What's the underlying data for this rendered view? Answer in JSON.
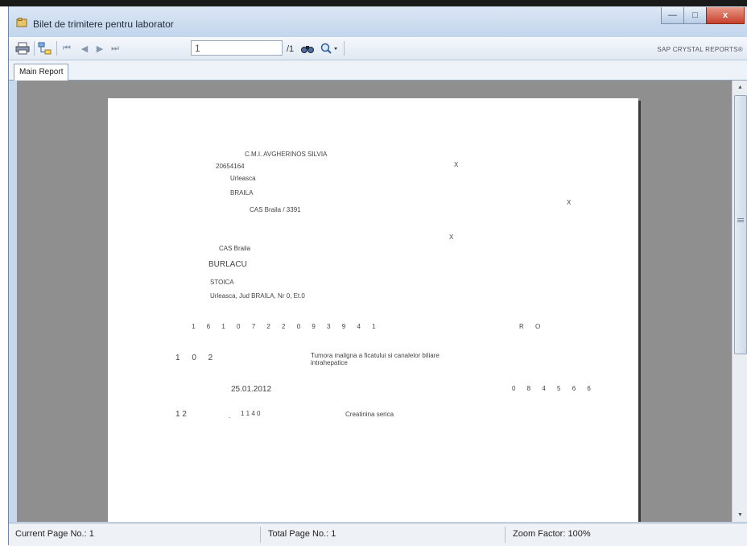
{
  "window": {
    "title": "Bilet de trimitere pentru laborator",
    "buttons": {
      "minimize": "—",
      "maximize": "□",
      "close": "x"
    }
  },
  "toolbar": {
    "page_input": "1",
    "page_total": "/1",
    "brand": "SAP CRYSTAL REPORTS®",
    "icons": [
      "print-icon",
      "group-tree-icon",
      "first-page-icon",
      "previous-page-icon",
      "next-page-icon",
      "last-page-icon",
      "find-icon",
      "zoom-icon"
    ]
  },
  "tabs": [
    {
      "label": "Main Report"
    }
  ],
  "report": {
    "clinic_name": "C.M.I. AVGHERINOS SILVIA",
    "code": "20654164",
    "street": "Urleasca",
    "locality": "BRAILA",
    "cas_contract": "CAS Braila / 3391",
    "cas": "CAS Braila",
    "patient_last_name": "BURLACU",
    "patient_first_name": "STOICA",
    "patient_address": "Urleasca, Jud BRAILA, Nr 0, Et.0",
    "cnp": "1 6 1 0 7 2 2 0 9 3 9 4 1",
    "citizenship": "R O",
    "diagnosis_code": "1 0 2",
    "diagnosis_line1": "Tumora maligna a ficatului si canalelor biliare",
    "diagnosis_line2": "intrahepatice",
    "date": "25.01.2012",
    "physician_code": "0 8 4 5 6 6",
    "analysis_index": "1   2",
    "analysis_code": "1  1  4  0",
    "analysis_name": "Creatinina serica",
    "mark": "X"
  },
  "status": {
    "current_page": "Current Page No.: 1",
    "total_page": "Total Page No.: 1",
    "zoom": "Zoom Factor: 100%"
  }
}
